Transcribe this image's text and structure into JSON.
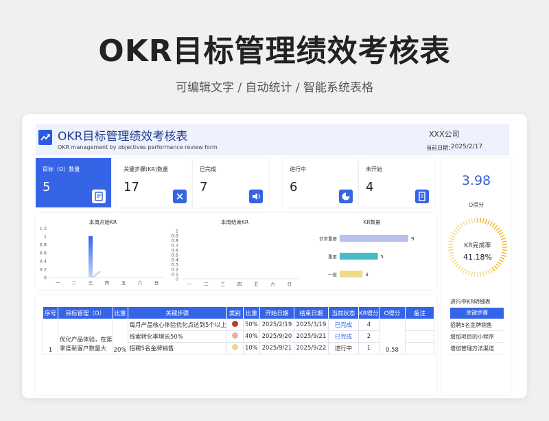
{
  "banner": {
    "title": "OKR目标管理绩效考核表",
    "subtitle": "可编辑文字 / 自动统计 / 智能系统表格"
  },
  "header": {
    "title": "OKR目标管理绩效考核表",
    "subtitle_en": "OKR management by objectives performance review form",
    "company": "XXX公司",
    "date_label": "当前日期：",
    "date": "2025/2/17"
  },
  "stats": [
    {
      "label": "目标（O）数量",
      "value": "5",
      "icon": "clipboard-icon"
    },
    {
      "label": "关键步骤(KR)数量",
      "value": "17",
      "icon": "shuffle-icon"
    },
    {
      "label": "已完成",
      "value": "7",
      "icon": "megaphone-icon"
    },
    {
      "label": "进行中",
      "value": "6",
      "icon": "pie-icon"
    },
    {
      "label": "未开始",
      "value": "4",
      "icon": "document-icon"
    }
  ],
  "score": {
    "value": "3.98",
    "label": "O得分",
    "completion_label": "KR完成率",
    "completion_value": "41.18%",
    "completion_rate": 0.4118
  },
  "kr_detail": {
    "title": "进行中KR明细表",
    "header": "关键步骤",
    "items": [
      "招聘5名金牌销售",
      "增加项目的小程序",
      "增加管理方法渠道"
    ]
  },
  "chart_data": [
    {
      "type": "bar",
      "title": "本周开始KR",
      "categories": [
        "一",
        "二",
        "三",
        "四",
        "五",
        "六",
        "日"
      ],
      "values": [
        0,
        0,
        1,
        0,
        0,
        0,
        0
      ],
      "ylim": [
        0,
        1.2
      ],
      "yticks": [
        "0",
        "0.2",
        "0.4",
        "0.6",
        "0.8",
        "1",
        "1.2"
      ]
    },
    {
      "type": "bar",
      "title": "本周结束KR",
      "categories": [
        "一",
        "二",
        "三",
        "四",
        "五",
        "六",
        "日"
      ],
      "values": [
        0,
        0,
        0,
        0,
        0,
        0,
        0
      ],
      "ylim": [
        0,
        1
      ],
      "yticks": [
        "0",
        "0.1",
        "0.2",
        "0.3",
        "0.4",
        "0.5",
        "0.6",
        "0.7",
        "0.8",
        "0.9",
        "1"
      ]
    },
    {
      "type": "bar",
      "orientation": "horizontal",
      "title": "KR数量",
      "categories": [
        "非常重要",
        "重要",
        "一般"
      ],
      "values": [
        9,
        5,
        3
      ],
      "colors": [
        "#b8c1ee",
        "#45bcc6",
        "#efd98a"
      ]
    }
  ],
  "table": {
    "headers": [
      "序号",
      "目标管理（O）",
      "比重",
      "关键步骤",
      "类别",
      "比重",
      "开始日期",
      "结束日期",
      "当前状态",
      "KR得分",
      "O得分",
      "备注"
    ],
    "rows": [
      {
        "step": "每月产品核心体验优化点达到5个以上",
        "color": "#c23a2b",
        "weight": "50%",
        "start": "2025/2/19",
        "end": "2025/3/19",
        "status": "已完成",
        "kr": "4"
      },
      {
        "step": "线索转化率增长50%",
        "color": "#eab0a6",
        "weight": "40%",
        "start": "2025/9/20",
        "end": "2025/9/21",
        "status": "已完成",
        "kr": "2"
      },
      {
        "step": "招聘5名金牌销售",
        "color": "#eed49c",
        "weight": "10%",
        "start": "2025/9/21",
        "end": "2025/9/22",
        "status": "进行中",
        "kr": "1"
      }
    ],
    "group": {
      "index": "1",
      "objective_line1": "优化产品体验，在第",
      "objective_line2": "季度新客户数量大",
      "weight": "20%",
      "o_score": "0.58"
    }
  }
}
